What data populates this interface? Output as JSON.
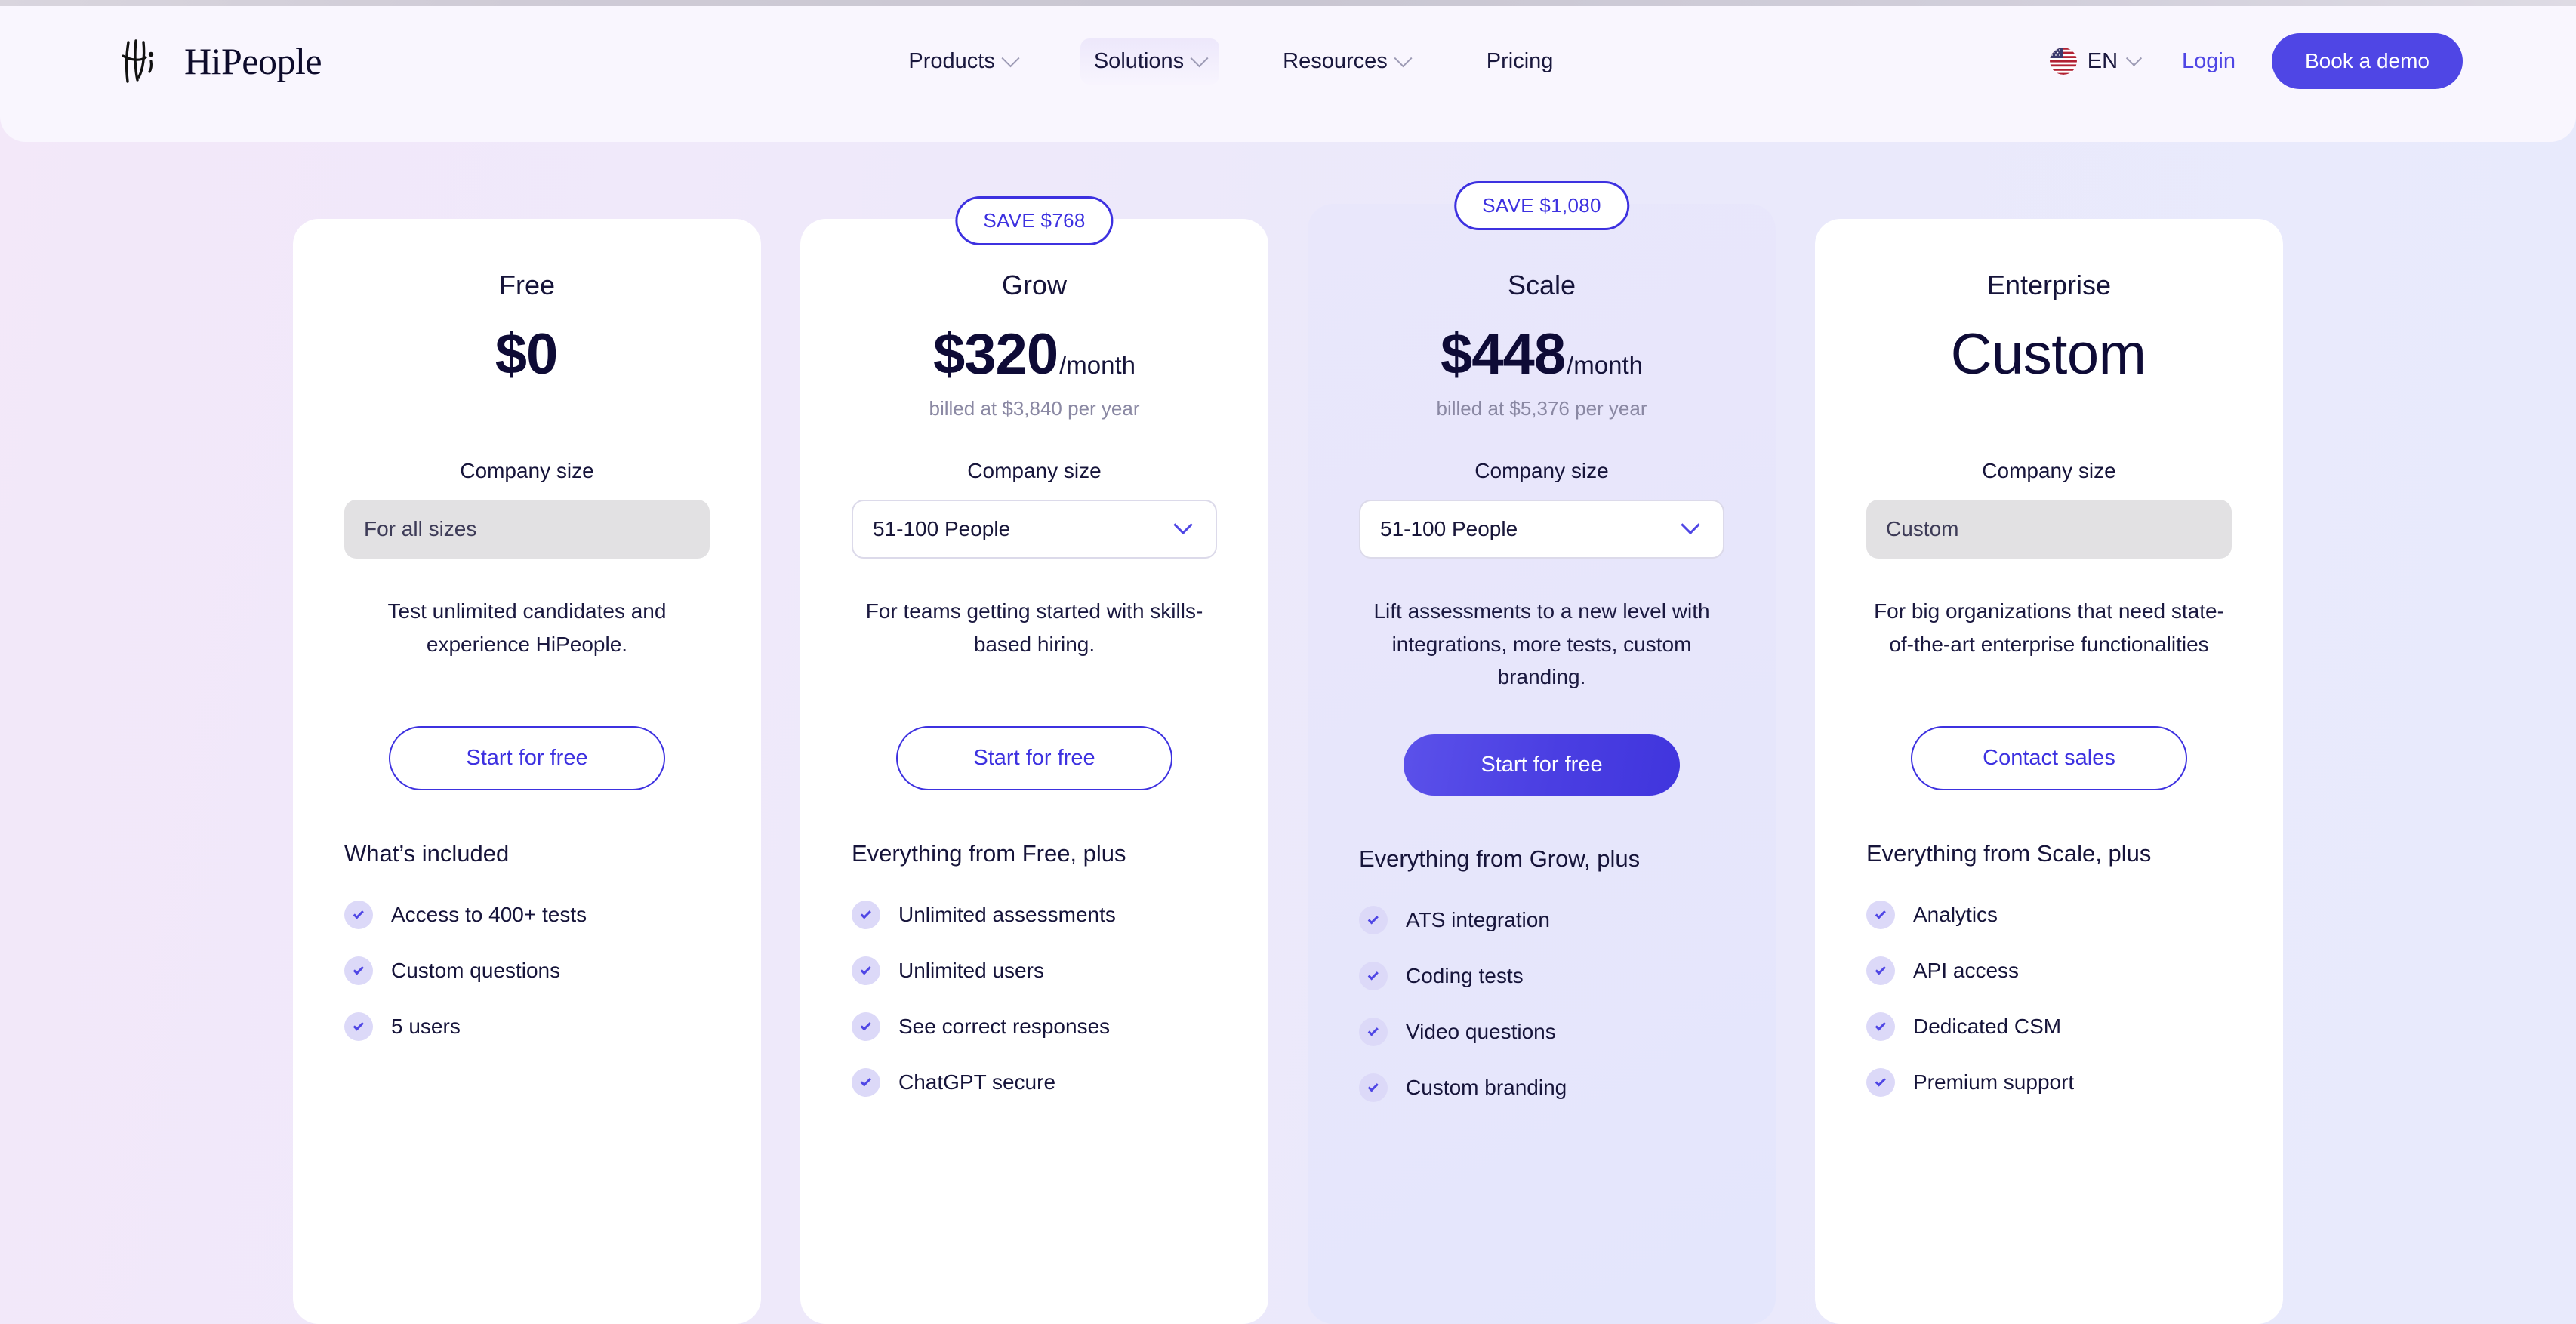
{
  "header": {
    "logo_text": "HiPeople",
    "logo_icon": "hipeople-mark-icon",
    "nav": [
      {
        "label": "Products",
        "has_dropdown": true
      },
      {
        "label": "Solutions",
        "has_dropdown": true
      },
      {
        "label": "Resources",
        "has_dropdown": true
      },
      {
        "label": "Pricing",
        "has_dropdown": false
      }
    ],
    "language": {
      "code": "EN",
      "flag": "us-flag-icon"
    },
    "login_label": "Login",
    "demo_label": "Book a demo"
  },
  "theme": {
    "accent": "#4f46e5",
    "accent_dark": "#3d31e0",
    "text_dark": "#16143a",
    "muted": "#8a88a3",
    "check_bg": "#dcd9f8"
  },
  "plans": [
    {
      "badge": "",
      "name": "Free",
      "price": "$0",
      "period": "",
      "billed": "",
      "company_size_label": "Company size",
      "company_size_value": "For all sizes",
      "company_size_interactive": false,
      "description": "Test unlimited candidates  and experience HiPeople.",
      "cta_label": "Start for free",
      "cta_style": "outline",
      "included_title": "What’s included",
      "features": [
        "Access to 400+ tests",
        "Custom questions",
        "5 users"
      ]
    },
    {
      "badge": "SAVE $768",
      "name": "Grow",
      "price": "$320",
      "period": "/month",
      "billed": "billed at $3,840 per year",
      "company_size_label": "Company size",
      "company_size_value": "51-100 People",
      "company_size_interactive": true,
      "description": "For teams getting started with skills-based hiring.",
      "cta_label": "Start for free",
      "cta_style": "outline",
      "included_title": "Everything from Free, plus",
      "features": [
        "Unlimited assessments",
        "Unlimited users",
        "See correct responses",
        "ChatGPT secure"
      ]
    },
    {
      "badge": "SAVE $1,080",
      "name": "Scale",
      "price": "$448",
      "period": "/month",
      "billed": "billed at $5,376 per year",
      "company_size_label": "Company size",
      "company_size_value": "51-100 People",
      "company_size_interactive": true,
      "description": "Lift assessments to a new level with integrations, more tests, custom branding.",
      "cta_label": "Start for free",
      "cta_style": "filled",
      "included_title": "Everything from Grow, plus",
      "features": [
        "ATS integration",
        "Coding tests",
        "Video questions",
        "Custom branding"
      ]
    },
    {
      "badge": "",
      "name": "Enterprise",
      "price": "Custom",
      "period": "",
      "billed": "",
      "company_size_label": "Company size",
      "company_size_value": "Custom",
      "company_size_interactive": false,
      "description": "For big organizations that need state-of-the-art enterprise functionalities",
      "cta_label": "Contact sales",
      "cta_style": "outline",
      "included_title": "Everything from Scale, plus",
      "features": [
        "Analytics",
        "API access",
        "Dedicated CSM",
        "Premium support"
      ]
    }
  ]
}
